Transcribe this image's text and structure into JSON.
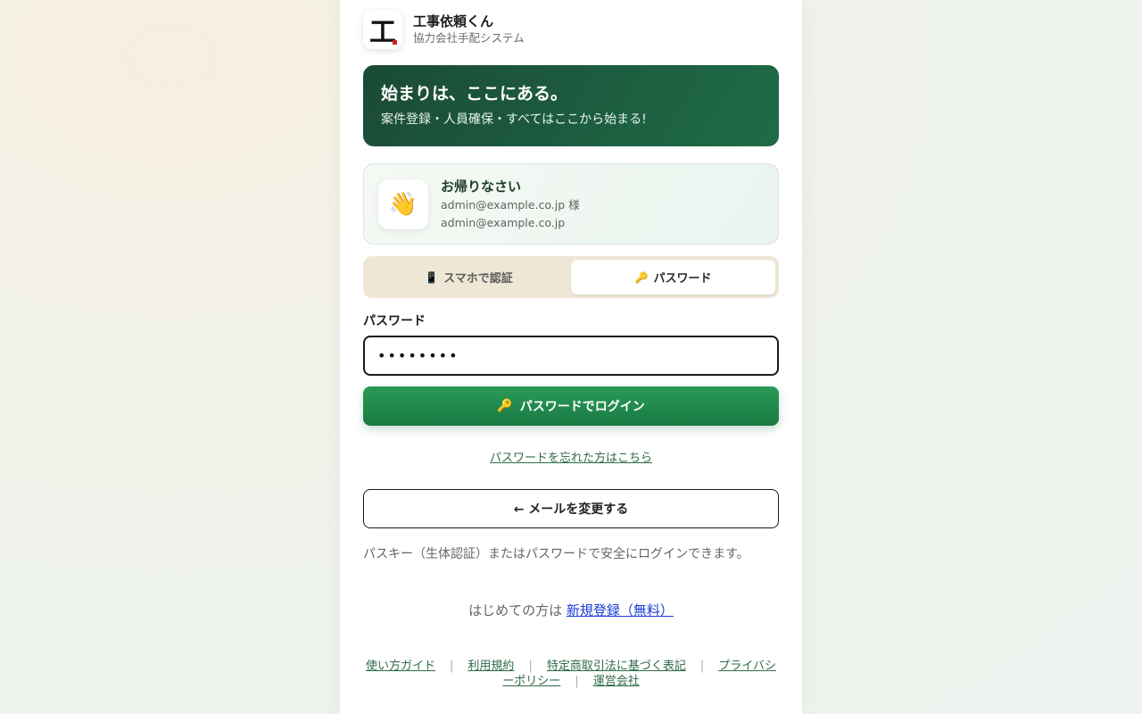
{
  "brand": {
    "logo_char": "工",
    "name": "工事依頼くん",
    "subtitle": "協力会社手配システム"
  },
  "hero": {
    "title": "始まりは、ここにある。",
    "subtitle": "案件登録・人員確保・すべてはここから始まる!"
  },
  "welcome": {
    "icon": "👋",
    "title": "お帰りなさい",
    "greeting": "admin@example.co.jp 様",
    "email": "admin@example.co.jp"
  },
  "tabs": [
    {
      "icon": "📱",
      "label": "スマホで認証",
      "active": false
    },
    {
      "icon": "🔑",
      "label": "パスワード",
      "active": true
    }
  ],
  "password": {
    "label": "パスワード",
    "value": "••••••••"
  },
  "login_button": {
    "icon": "🔑",
    "label": "パスワードでログイン"
  },
  "forgot_link": "パスワードを忘れた方はこちら",
  "change_email_button": "← メールを変更する",
  "note": "パスキー（生体認証）またはパスワードで安全にログインできます。",
  "signup": {
    "prefix": "はじめての方は",
    "link": "新規登録（無料）"
  },
  "footer_links": [
    "使い方ガイド",
    "利用規約",
    "特定商取引法に基づく表記",
    "プライバシーポリシー",
    "運営会社"
  ],
  "colors": {
    "hero": "#1e5c40",
    "primary_button": "#22894e",
    "tab_bg": "#efe7d6",
    "link": "#2f6b4a",
    "signup_link": "#1a3cd6"
  }
}
